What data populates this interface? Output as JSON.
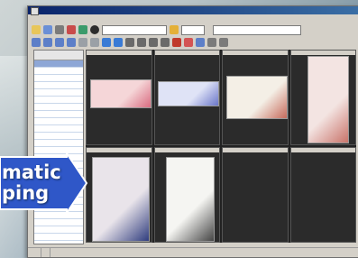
{
  "window": {
    "title": "",
    "menu": [
      "",
      "",
      "",
      "",
      "",
      "",
      ""
    ]
  },
  "toolbar": {
    "search_value": "",
    "colors": [
      "#2e7d32",
      "#c62828",
      "#1565c0",
      "#f9a825",
      "#6a1b9a",
      "#00838f",
      "#ef6c00",
      "#37474f"
    ]
  },
  "callout": {
    "line1": "matic",
    "line2": "ping",
    "fill": "#2f57c8"
  },
  "status": [
    "",
    "",
    ""
  ],
  "documents": [
    {
      "kind": "cheque",
      "color": "#f5d6d8",
      "accent": "#d96b80"
    },
    {
      "kind": "cheque",
      "color": "#dfe3f6",
      "accent": "#6a76c9"
    },
    {
      "kind": "form",
      "color": "#f4efe6",
      "accent": "#c66b5c"
    },
    {
      "kind": "receipt",
      "color": "#f3e4e2",
      "accent": "#c9746a"
    },
    {
      "kind": "magazine",
      "color": "#e9e4ea",
      "accent": "#2f3c7e"
    },
    {
      "kind": "newspaper",
      "color": "#f5f5f2",
      "accent": "#444444"
    }
  ]
}
